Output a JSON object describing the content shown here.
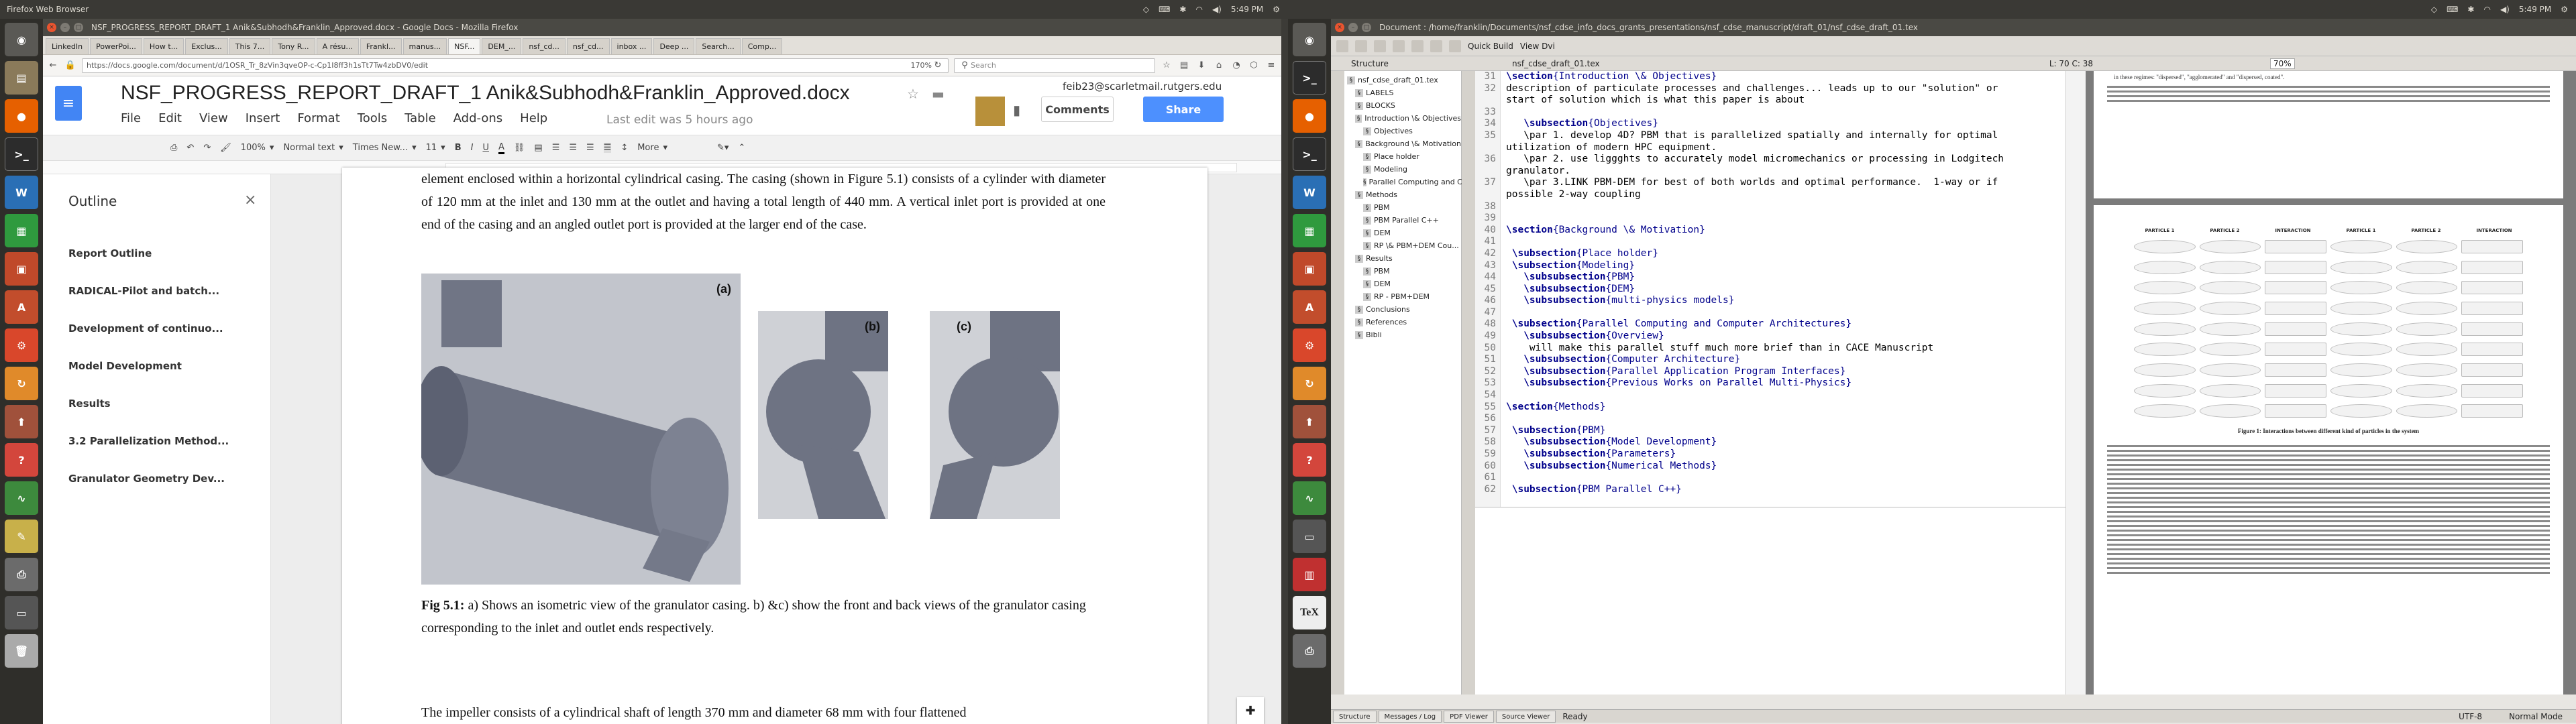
{
  "left_topbar": {
    "title": "Firefox Web Browser",
    "time": "5:49 PM"
  },
  "right_topbar": {
    "time": "5:49 PM"
  },
  "launcher_left": [
    "Ubuntu",
    "Files",
    "Firefox",
    "Terminal",
    "Writer",
    "Calc",
    "Impress",
    "Settings",
    "Software",
    "Monitor"
  ],
  "firefox": {
    "window_title": "NSF_PROGRESS_REPORT_DRAFT_1 Anik&Subhodh&Franklin_Approved.docx - Google Docs - Mozilla Firefox",
    "tabs": [
      "LinkedIn",
      "PowerPoi...",
      "How t...",
      "Exclus...",
      "This 7...",
      "Tony R...",
      "A résu...",
      "Frankl...",
      "manus...",
      "NSF...",
      "DEM_...",
      "nsf_cd...",
      "nsf_cd...",
      "inbox ...",
      "Deep ...",
      "Search...",
      "Comp..."
    ],
    "url": "https://docs.google.com/document/d/1OSR_Tr_8zVin3qveOP-c-Cp1I8ff3h1sTt7Tw4zbDV0/edit",
    "zoom": "170%",
    "search_placeholder": "Search"
  },
  "gdocs": {
    "doc_title": "NSF_PROGRESS_REPORT_DRAFT_1 Anik&Subhodh&Franklin_Approved.docx",
    "user_email": "feib23@scarletmail.rutgers.edu",
    "menus": [
      "File",
      "Edit",
      "View",
      "Insert",
      "Format",
      "Tools",
      "Table",
      "Add-ons",
      "Help"
    ],
    "last_edit": "Last edit was 5 hours ago",
    "comments_label": "Comments",
    "share_label": "Share",
    "zoom": "100%",
    "style": "Normal text",
    "font": "Times New...",
    "font_size": "11",
    "more_label": "More",
    "outline_title": "Outline",
    "outline_items": [
      "Report Outline",
      "RADICAL-Pilot and batch...",
      "Development of continuo...",
      "Model Development",
      "Results",
      "3.2 Parallelization Method...",
      "Granulator Geometry Dev..."
    ],
    "para_top": "element enclosed within a horizontal cylindrical casing. The casing (shown in Figure 5.1) consists of a cylinder with diameter of 120 mm at the inlet and 130 mm at the outlet and having a total length of 440 mm. A vertical inlet port is provided at one end of the casing and an angled outlet port is provided at the larger end of the case.",
    "fig_labels": [
      "(a)",
      "(b)",
      "(c)"
    ],
    "caption_bold": "Fig 5.1:",
    "caption_text": " a) Shows an isometric view of the granulator casing. b) &c) show the front and back views of the granulator casing corresponding to the inlet and outlet ends respectively.",
    "para_bottom": "The impeller consists of a cylindrical shaft of length 370 mm and diameter 68 mm with four flattened"
  },
  "kile": {
    "window_title": "Document : /home/franklin/Documents/nsf_cdse_info_docs_grants_presentations/nsf_cdse_manuscript/draft_01/nsf_cdse_draft_01.tex",
    "toolbar": {
      "quick_build": "Quick Build",
      "view_dvi": "View Dvi"
    },
    "structure_label": "Structure",
    "file_tab": "nsf_cdse_draft_01.tex",
    "cursor_pos": "L: 70 C: 38",
    "pdf_zoom": "70%",
    "structure_items": [
      "nsf_cdse_draft_01.tex",
      "LABELS",
      "BLOCKS",
      "Introduction \\& Objectives",
      "Objectives",
      "Background \\& Motivation",
      "Place holder",
      "Modeling",
      "Parallel Computing and Cluster...",
      "Methods",
      "PBM",
      "PBM Parallel C++",
      "DEM",
      "RP \\& PBM+DEM Cou...",
      "Results",
      "PBM",
      "DEM",
      "RP - PBM+DEM",
      "Conclusions",
      "References",
      "Bibli"
    ],
    "line_numbers": [
      "31",
      "32",
      "",
      "33",
      "34",
      "35",
      "",
      "36",
      "",
      "37",
      "",
      "38",
      "39",
      "40",
      "41",
      "42",
      "43",
      "44",
      "45",
      "46",
      "47",
      "48",
      "49",
      "50",
      "51",
      "52",
      "53",
      "54",
      "55",
      "56",
      "57",
      "58",
      "59",
      "60",
      "61",
      "62"
    ],
    "code_lines": [
      "\\section{Introduction \\& Objectives}",
      "description of particulate processes and challenges... leads up to our \"solution\" or",
      "start of solution which is what this paper is about",
      "",
      "   \\subsection{Objectives}",
      "   \\par 1. develop 4D? PBM that is parallelized spatially and internally for optimal",
      "utilization of modern HPC equipment.",
      "   \\par 2. use liggghts to accurately model micromechanics or processing in Lodgitech",
      "granulator.",
      "   \\par 3.LINK PBM-DEM for best of both worlds and optimal performance.  1-way or if",
      "possible 2-way coupling",
      "",
      "",
      "\\section{Background \\& Motivation}",
      "",
      " \\subsection{Place holder}",
      " \\subsection{Modeling}",
      "   \\subsubsection{PBM}",
      "   \\subsubsection{DEM}",
      "   \\subsubsection{multi-physics models}",
      "",
      " \\subsection{Parallel Computing and Computer Architectures}",
      "   \\subsubsection{Overview}",
      "    will make this parallel stuff much more brief than in CACE Manuscript",
      "   \\subsubsection{Computer Architecture}",
      "   \\subsubsection{Parallel Application Program Interfaces}",
      "   \\subsubsection{Previous Works on Parallel Multi-Physics}",
      "",
      "\\section{Methods}",
      "",
      " \\subsection{PBM}",
      "   \\subsubsection{Model Development}",
      "   \\subsubsection{Parameters}",
      "   \\subsubsection{Numerical Methods}",
      "",
      " \\subsection{PBM Parallel C++}"
    ],
    "pdf_top_text": "in these regimes: \"dispersed\", \"agglomerated\" and \"dispersed, coated\".",
    "pdf_fig_caption": "Figure 1: Interactions between different kind of particles in the system",
    "pdf_col_headers": [
      "PARTICLE 1",
      "PARTICLE 2",
      "INTERACTION",
      "PARTICLE 1",
      "PARTICLE 2",
      "INTERACTION"
    ],
    "status_tabs": [
      "Structure",
      "Messages / Log",
      "PDF Viewer",
      "Source Viewer"
    ],
    "status_ready": "Ready",
    "encoding": "UTF-8",
    "mode": "Normal Mode"
  }
}
